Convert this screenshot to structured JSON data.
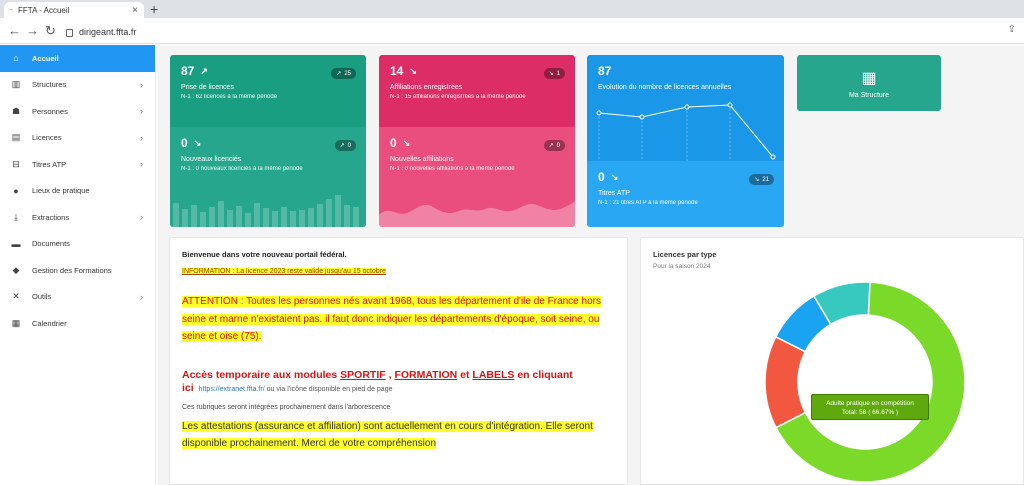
{
  "browser": {
    "tab_title": "FFTA - Accueil",
    "tab_icon": "--",
    "url": "dirigeant.ffta.fr"
  },
  "sidebar": {
    "items": [
      {
        "label": "Accueil",
        "icon": "home-icon"
      },
      {
        "label": "Structures",
        "icon": "building-icon"
      },
      {
        "label": "Personnes",
        "icon": "people-icon"
      },
      {
        "label": "Licences",
        "icon": "license-icon"
      },
      {
        "label": "Titres ATP",
        "icon": "title-icon"
      },
      {
        "label": "Lieux de pratique",
        "icon": "location-icon"
      },
      {
        "label": "Extractions",
        "icon": "download-icon"
      },
      {
        "label": "Documents",
        "icon": "folder-icon"
      },
      {
        "label": "Gestion des Formations",
        "icon": "graduation-icon"
      },
      {
        "label": "Outils",
        "icon": "tools-icon"
      },
      {
        "label": "Calendrier",
        "icon": "calendar-icon"
      }
    ]
  },
  "cards": {
    "licences": {
      "value": "87",
      "title": "Prise de licences",
      "sub": "N-1 : 62 licences à la même période",
      "badge": "25",
      "new_value": "0",
      "new_title": "Nouveaux licenciés",
      "new_sub": "N-1 : 0 nouveaux licenciés à la même période",
      "new_badge": "0"
    },
    "affiliations": {
      "value": "14",
      "title": "Affiliations enregistrées",
      "sub": "N-1 : 15 affiliations enregistrées à la même période",
      "badge": "1",
      "new_value": "0",
      "new_title": "Nouvelles affiliations",
      "new_sub": "N-1 : 0 nouvelles affiliations à la même période",
      "new_badge": "0"
    },
    "evolution": {
      "value": "87",
      "title": "Evolution du nombre de licences annuelles",
      "atp_value": "0",
      "atp_title": "Titres ATP",
      "atp_sub": "N-1 : 21 titres ATP à la même période",
      "atp_badge": "21"
    },
    "structure": {
      "label": "Ma Structure"
    }
  },
  "welcome": {
    "title": "Bienvenue dans votre nouveau portail fédéral.",
    "info": "INFORMATION : La licence 2023 reste valide jusqu'au 15 octobre",
    "attention": "ATTENTION : Toutes les personnes nés avant 1968, tous les département d'ile de France hors seine et marne n'existaient pas. il faut donc indiquer les départements d'époque, soit seine, ou seine et oise (75).",
    "acces_prefix": "Accès temporaire aux modules",
    "sportif": "SPORTIF",
    "formation": "FORMATION",
    "et": "et",
    "labels": "LABELS",
    "acces_suffix": "en cliquant",
    "ici": "ici",
    "link": "https://extranet.ffta.fr/",
    "link_suffix": "ou via l'icône disponible en pied de page",
    "rubriques": "Ces rubriques seront intégrées prochainement dans l'arborescence",
    "attestations": "Les attestations (assurance et affiliation) sont actuellement en cours d'intégration. Elle seront disponible prochainement. Merci de votre compréhension"
  },
  "licences_panel": {
    "title": "Licences par type",
    "subtitle": "Pour la saison 2024",
    "tooltip_line1": "Adulte pratique en compétition",
    "tooltip_line2": "Total: 58 ( 66.67% )"
  },
  "chart_data": {
    "type": "pie",
    "series": [
      {
        "name": "Adulte pratique en compétition",
        "value": 66.67,
        "color": "#7bd92a"
      },
      {
        "value": 15,
        "color": "#f2573f"
      },
      {
        "value": 9,
        "color": "#19a3f0"
      },
      {
        "value": 9.33,
        "color": "#37c8c0"
      }
    ]
  }
}
